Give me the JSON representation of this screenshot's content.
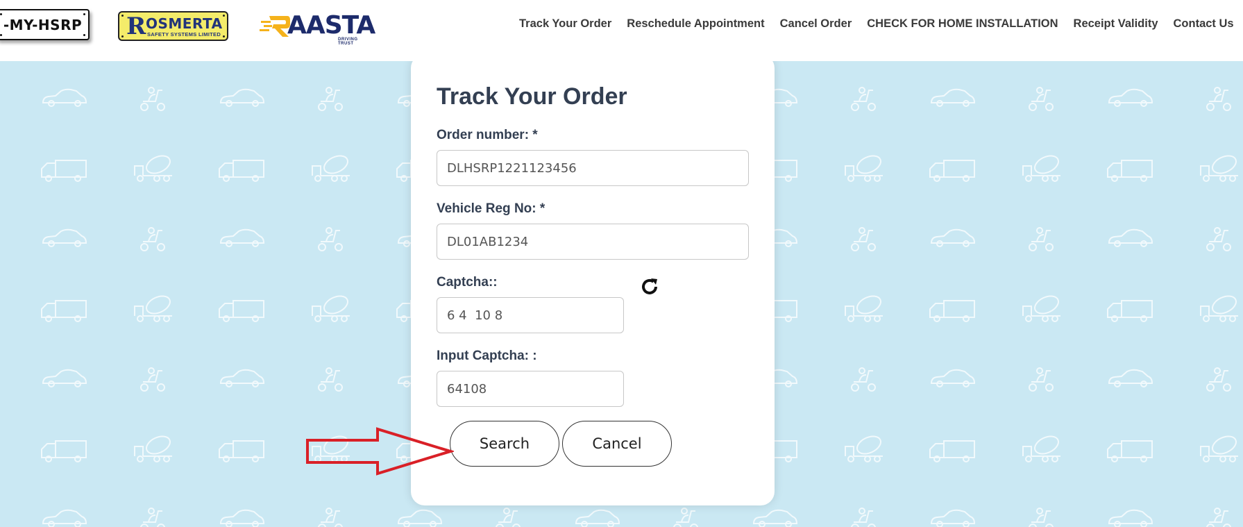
{
  "header": {
    "logos": {
      "myhsrp": "-MY-HSRP",
      "rosmerta_initial": "R",
      "rosmerta_word": "OSMERTA",
      "rosmerta_sub": "SAFETY SYSTEMS LIMITED",
      "raasta_word": "AASTA",
      "raasta_sub": "DRIVING TRUST"
    },
    "nav": [
      "Track Your Order",
      "Reschedule Appointment",
      "Cancel Order",
      "CHECK FOR HOME INSTALLATION",
      "Receipt Validity",
      "Contact Us"
    ]
  },
  "form": {
    "title": "Track Your Order",
    "order_label": "Order number: *",
    "order_value": "DLHSRP1221123456",
    "vehicle_label": "Vehicle Reg No: *",
    "vehicle_value": "DL01AB1234",
    "captcha_label": "Captcha::",
    "captcha_value": "6 4  10 8",
    "input_captcha_label": "Input Captcha: :",
    "input_captcha_value": "64108",
    "search_label": "Search",
    "cancel_label": "Cancel",
    "refresh_icon": "refresh-icon"
  },
  "colors": {
    "background": "#cae8f3",
    "heading": "#333f52",
    "annotation_arrow": "#d92027",
    "raasta_accent": "#f5b21b",
    "rosmerta_bg": "#f4ec6a"
  }
}
